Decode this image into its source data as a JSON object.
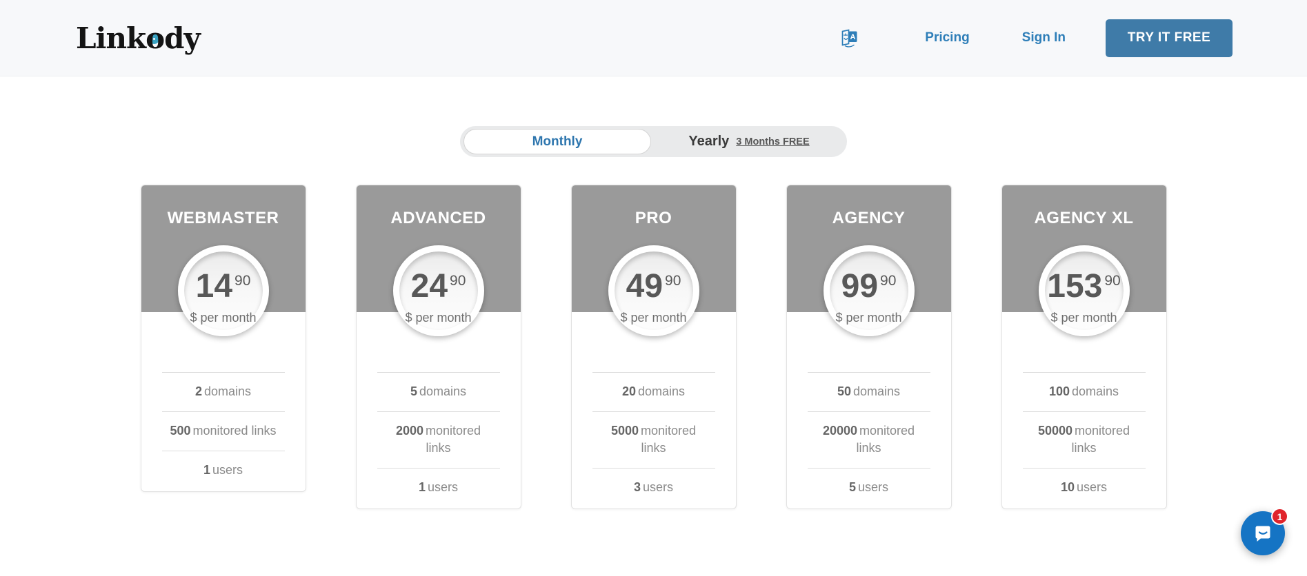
{
  "header": {
    "logo": "Linkody",
    "nav": {
      "pricing": "Pricing",
      "sign_in": "Sign In",
      "cta": "TRY IT FREE"
    },
    "language_icon": "translate-icon"
  },
  "toggle": {
    "monthly": "Monthly",
    "yearly": "Yearly",
    "yearly_badge": "3 Months FREE",
    "selected": "Monthly"
  },
  "plans": [
    {
      "name": "WEBMASTER",
      "price_major": "14",
      "price_minor": "90",
      "price_unit": "$ per month",
      "domains_value": "2",
      "domains_label": "domains",
      "links_value": "500",
      "links_label": "monitored links",
      "users_value": "1",
      "users_label": "users"
    },
    {
      "name": "ADVANCED",
      "price_major": "24",
      "price_minor": "90",
      "price_unit": "$ per month",
      "domains_value": "5",
      "domains_label": "domains",
      "links_value": "2000",
      "links_label": "monitored links",
      "users_value": "1",
      "users_label": "users"
    },
    {
      "name": "PRO",
      "price_major": "49",
      "price_minor": "90",
      "price_unit": "$ per month",
      "domains_value": "20",
      "domains_label": "domains",
      "links_value": "5000",
      "links_label": "monitored links",
      "users_value": "3",
      "users_label": "users"
    },
    {
      "name": "AGENCY",
      "price_major": "99",
      "price_minor": "90",
      "price_unit": "$ per month",
      "domains_value": "50",
      "domains_label": "domains",
      "links_value": "20000",
      "links_label": "monitored links",
      "users_value": "5",
      "users_label": "users"
    },
    {
      "name": "AGENCY XL",
      "price_major": "153",
      "price_minor": "90",
      "price_unit": "$ per month",
      "domains_value": "100",
      "domains_label": "domains",
      "links_value": "50000",
      "links_label": "monitored links",
      "users_value": "10",
      "users_label": "users"
    }
  ],
  "chat": {
    "unread_count": "1"
  },
  "colors": {
    "accent_blue": "#2e7eb8",
    "button_blue": "#3f7ba8",
    "card_header_gray": "#9a9a9a",
    "logo_ring_teal": "#3aa2c1",
    "toggle_track_gray": "#e9eaeb",
    "chat_blue": "#1574c4",
    "badge_red": "#e0242b",
    "header_bg": "#f7f8fa"
  }
}
